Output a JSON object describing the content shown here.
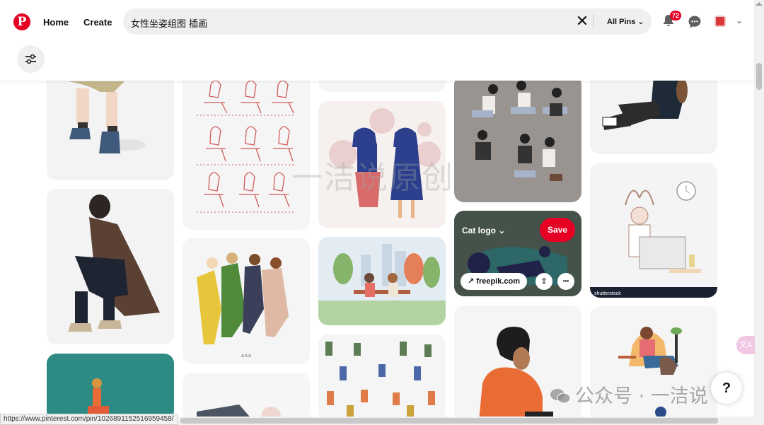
{
  "header": {
    "logo_letter": "P",
    "nav": {
      "home": "Home",
      "create": "Create"
    },
    "search": {
      "value": "女性坐姿组图 插画",
      "clear_glyph": "✕",
      "scope_label": "All Pins",
      "scope_chevron": "⌄"
    },
    "notifications_count": "72",
    "account_chevron": "⌄"
  },
  "pins": {
    "hover_pin": {
      "board_label": "Cat logo",
      "save_label": "Save",
      "source_label": "freepik.com",
      "link_arrow": "↗",
      "share_glyph": "⇪",
      "more_glyph": "•••"
    },
    "tile_captions": {
      "shutterstock": "shutterstock",
      "sketch_text": "A  A  A"
    }
  },
  "overlays": {
    "watermark": "一洁说原创",
    "wechat_text": "公众号 · 一洁说",
    "help_glyph": "?",
    "translate_glyph": "文A",
    "status_url": "https://www.pinterest.com/pin/1026891152516959458/"
  },
  "colors": {
    "brand": "#e60023",
    "tile": "#f3f3f3"
  }
}
